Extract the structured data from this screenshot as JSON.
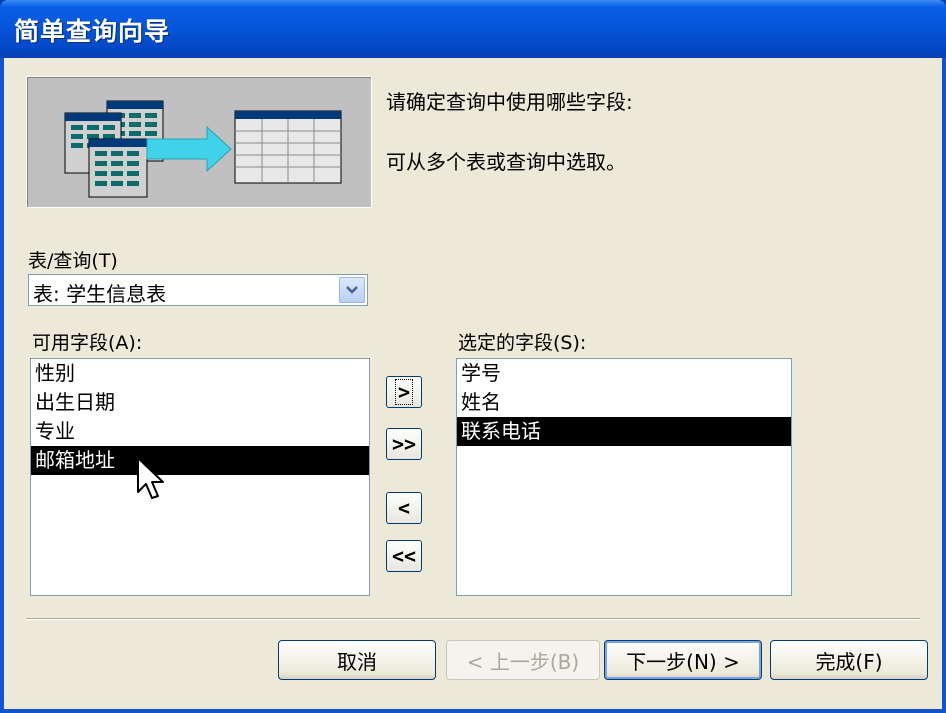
{
  "window": {
    "title": "简单查询向导"
  },
  "prompt": {
    "line1": "请确定查询中使用哪些字段:",
    "line2": "可从多个表或查询中选取。"
  },
  "table_query": {
    "label": "表/查询(T)",
    "selected": "表: 学生信息表"
  },
  "available": {
    "label": "可用字段(A):",
    "items": [
      "性别",
      "出生日期",
      "专业",
      "邮箱地址"
    ],
    "selected_index": 3
  },
  "selected_fields": {
    "label": "选定的字段(S):",
    "items": [
      "学号",
      "姓名",
      "联系电话"
    ],
    "selected_index": 2
  },
  "move_buttons": {
    "add_one": ">",
    "add_all": ">>",
    "remove_one": "<",
    "remove_all": "<<"
  },
  "footer": {
    "cancel": "取消",
    "back": "< 上一步(B)",
    "next": "下一步(N) >",
    "finish": "完成(F)"
  },
  "colors": {
    "title_bar": "#0554d8",
    "face": "#ECE9D8",
    "selection": "#000000",
    "illus_arrow": "#3fd2e8"
  }
}
